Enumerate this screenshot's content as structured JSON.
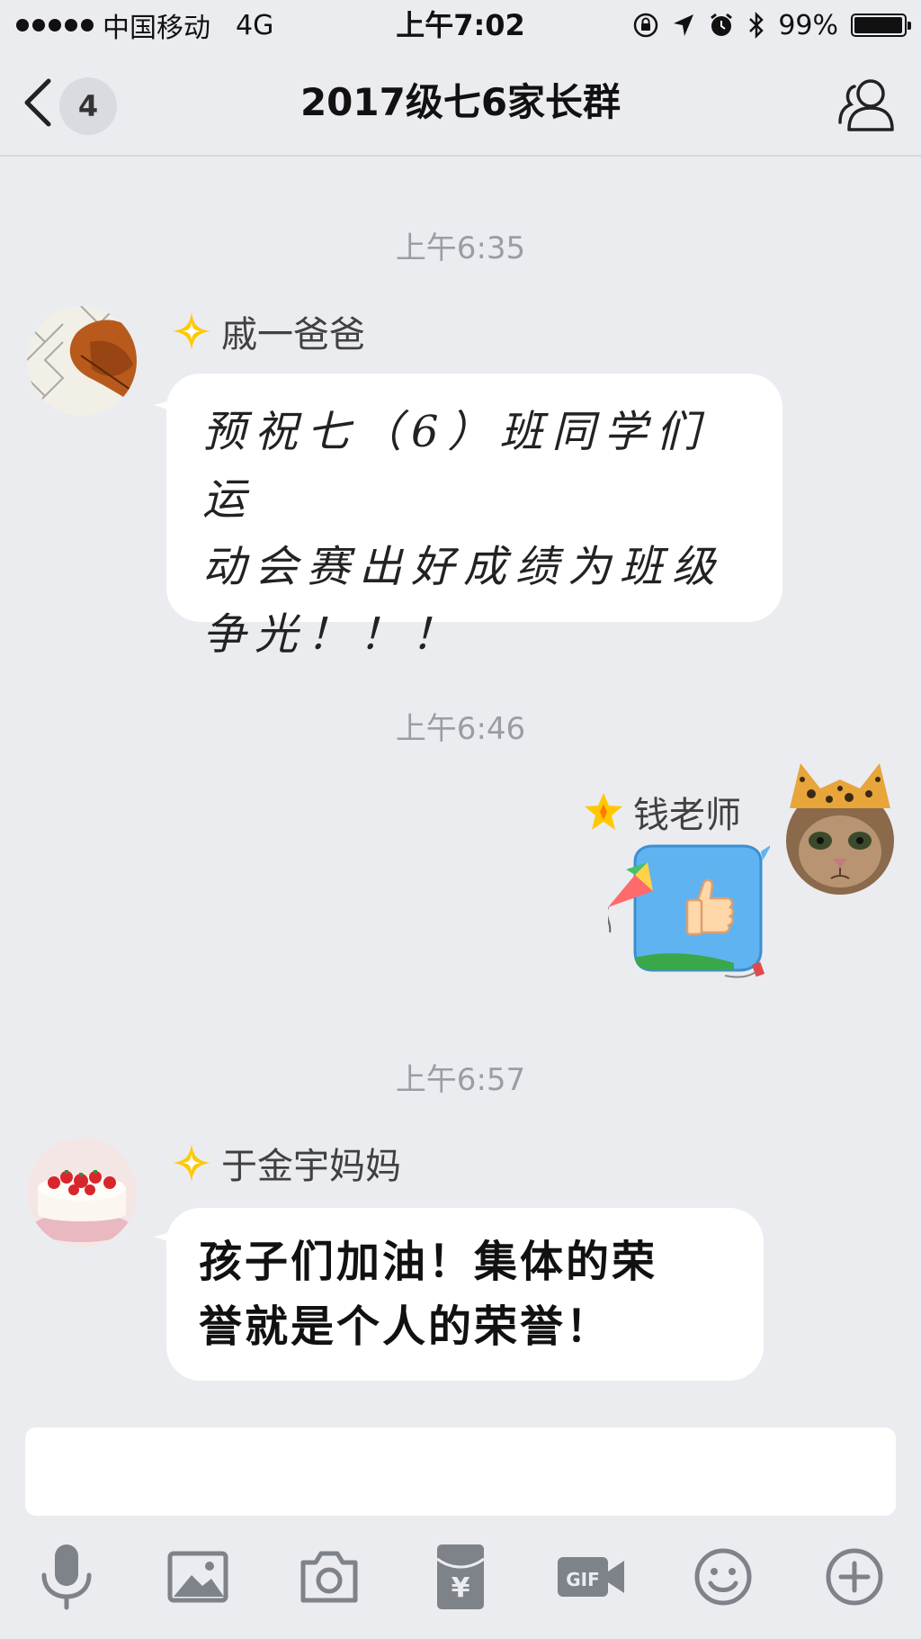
{
  "status_bar": {
    "carrier": "中国移动",
    "network": "4G",
    "time": "上午7:02",
    "battery_pct": "99%",
    "battery_level": 0.99,
    "icons": [
      "lock-rotation-icon",
      "location-arrow-icon",
      "alarm-icon",
      "bluetooth-icon"
    ]
  },
  "nav": {
    "unread_count": "4",
    "title": "2017级七6家长群"
  },
  "messages": [
    {
      "timestamp": "上午6:35",
      "sender": "戚一爸爸",
      "text_lines": [
        "预祝七（6）班同学们运",
        "动会赛出好成绩为班级",
        "争光！！！"
      ]
    },
    {
      "timestamp": "上午6:46",
      "sender": "钱老师",
      "sticker": "thumbs-up-sticker"
    },
    {
      "timestamp": "上午6:57",
      "sender": "于金宇妈妈",
      "text_lines": [
        "孩子们加油！集体的荣",
        "誉就是个人的荣誉！"
      ]
    }
  ],
  "input": {
    "placeholder": ""
  },
  "toolbar": {
    "items": [
      "microphone-icon",
      "image-icon",
      "camera-icon",
      "red-packet-icon",
      "gif-icon",
      "emoji-icon",
      "plus-icon"
    ],
    "gif_label": "GIF",
    "red_packet_symbol": "¥"
  },
  "colors": {
    "background": "#ebecf0",
    "bubble": "#ffffff",
    "timestamp": "#9c9ca3",
    "star": "#ffc800",
    "sticker_sky": "#5fb3f0",
    "icon_gray": "#7e8289"
  }
}
